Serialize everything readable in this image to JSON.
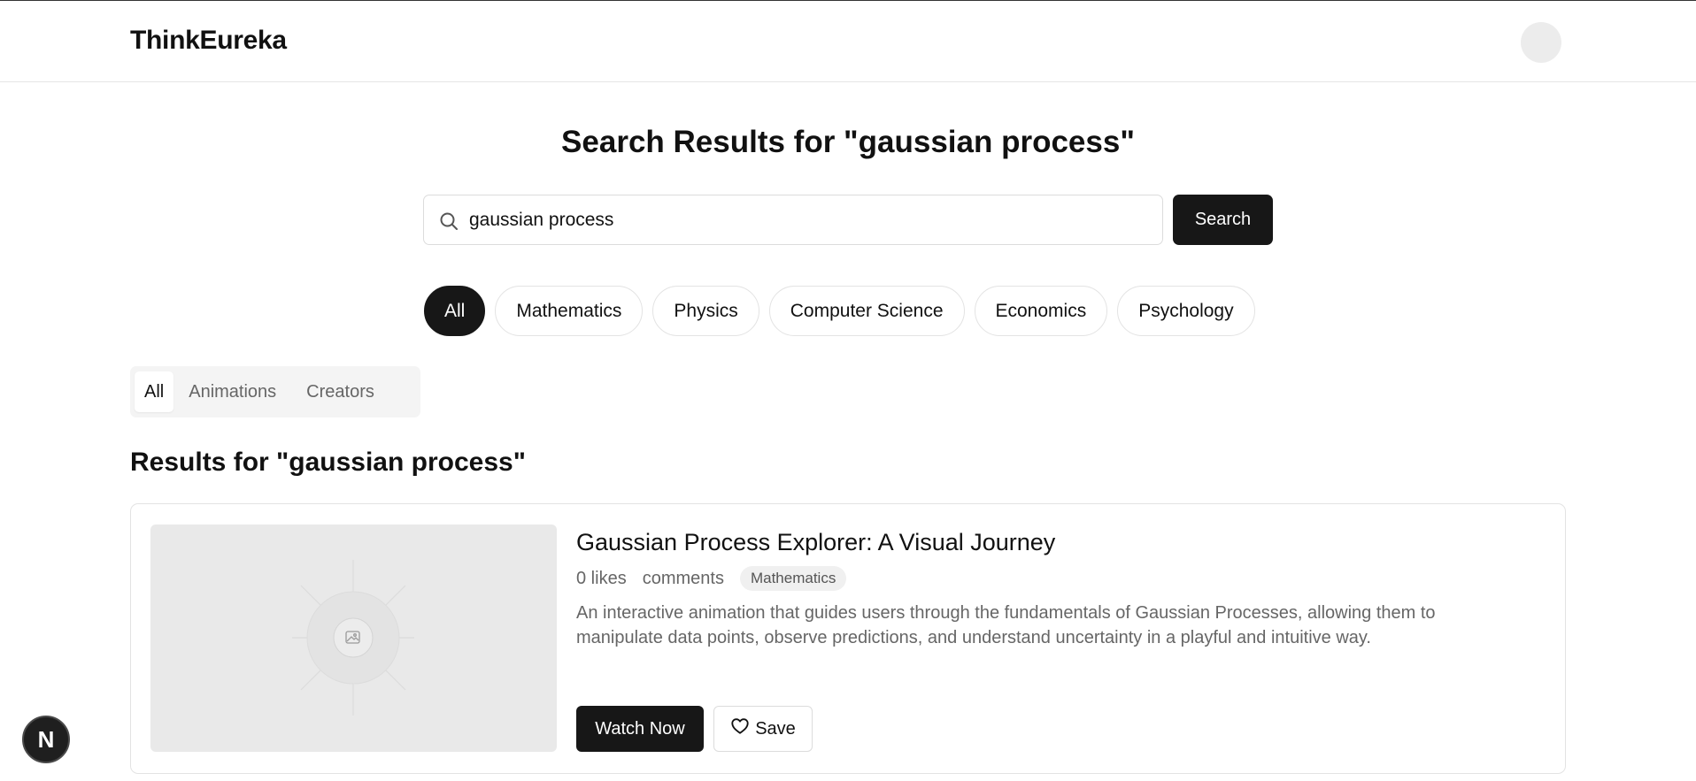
{
  "header": {
    "brand": "ThinkEureka"
  },
  "page": {
    "title": "Search Results for \"gaussian process\""
  },
  "search": {
    "value": "gaussian process",
    "button_label": "Search"
  },
  "categories": [
    {
      "label": "All",
      "active": true
    },
    {
      "label": "Mathematics",
      "active": false
    },
    {
      "label": "Physics",
      "active": false
    },
    {
      "label": "Computer Science",
      "active": false
    },
    {
      "label": "Economics",
      "active": false
    },
    {
      "label": "Psychology",
      "active": false
    }
  ],
  "tabs": [
    {
      "label": "All",
      "active": true
    },
    {
      "label": "Animations",
      "active": false
    },
    {
      "label": "Creators",
      "active": false
    }
  ],
  "results": {
    "heading": "Results for \"gaussian process\"",
    "items": [
      {
        "title": "Gaussian Process Explorer: A Visual Journey",
        "likes": "0 likes",
        "comments": "comments",
        "category": "Mathematics",
        "description": "An interactive animation that guides users through the fundamentals of Gaussian Processes, allowing them to manipulate data points, observe predictions, and understand uncertainty in a playful and intuitive way.",
        "watch_label": "Watch Now",
        "save_label": "Save"
      }
    ]
  },
  "dev_badge": {
    "letter": "N"
  },
  "colors": {
    "primary": "#171717",
    "muted_text": "#666666",
    "border": "#e3e3e3",
    "thumb_bg": "#e9e9e9"
  },
  "icons": {
    "search": "search-icon",
    "image_placeholder": "image-icon",
    "save": "heart-icon"
  }
}
